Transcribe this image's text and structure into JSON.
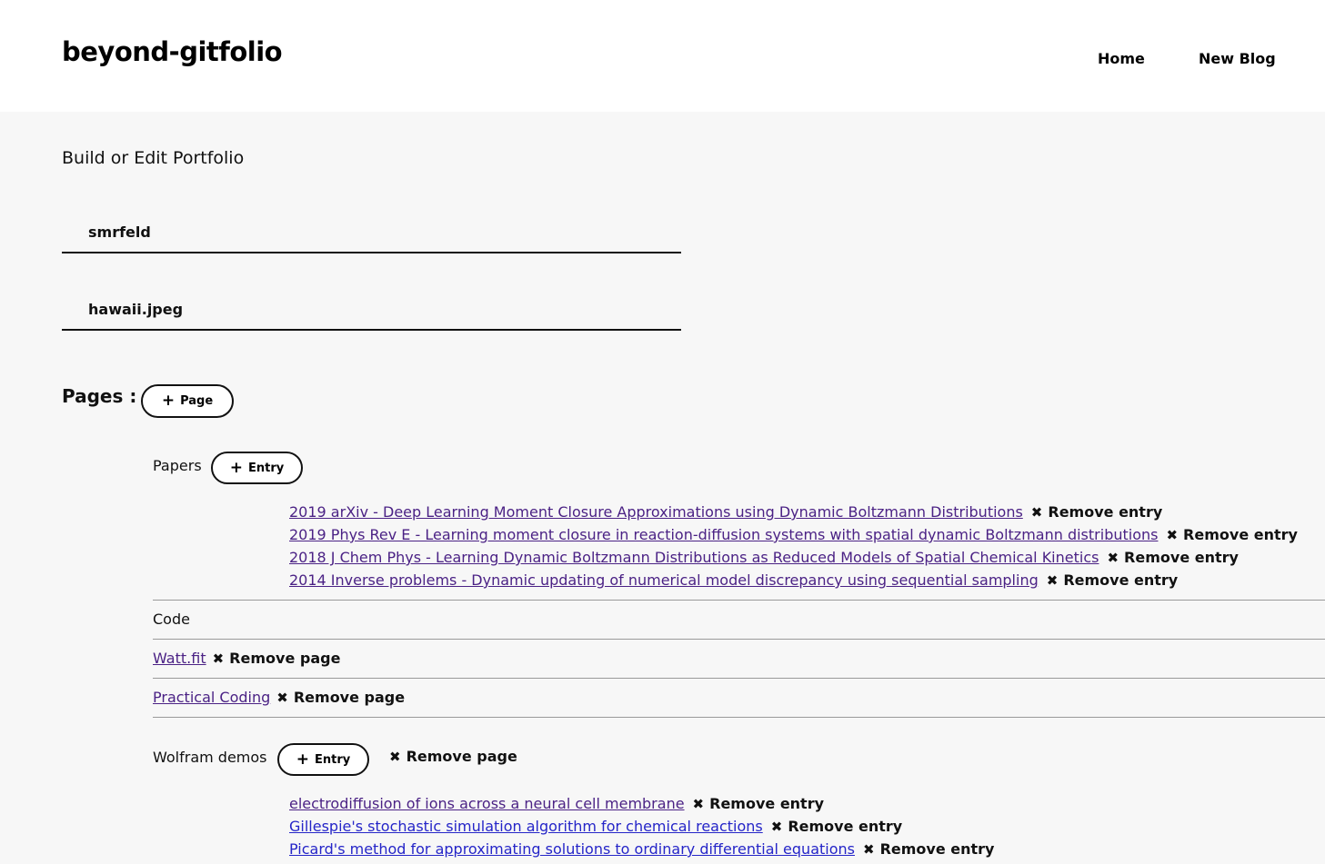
{
  "brand": "beyond-gitfolio",
  "nav": {
    "home": "Home",
    "new_blog": "New Blog"
  },
  "form": {
    "title": "Build or Edit Portfolio",
    "username_value": "smrfeld",
    "image_value": "hawaii.jpeg"
  },
  "pages_label": "Pages :",
  "add_page_label": "Page",
  "add_entry_label": "Entry",
  "remove_entry_label": "Remove entry",
  "remove_page_label": "Remove page",
  "papers": {
    "name": "Papers",
    "entries": [
      "2019 arXiv - Deep Learning Moment Closure Approximations using Dynamic Boltzmann Distributions",
      "2019 Phys Rev E - Learning moment closure in reaction-diffusion systems with spatial dynamic Boltzmann distributions",
      "2018 J Chem Phys - Learning Dynamic Boltzmann Distributions as Reduced Models of Spatial Chemical Kinetics",
      "2014 Inverse problems - Dynamic updating of numerical model discrepancy using sequential sampling"
    ]
  },
  "code": {
    "name": "Code"
  },
  "watt": {
    "name": "Watt.fit"
  },
  "practical": {
    "name": "Practical Coding"
  },
  "wolfram": {
    "name": "Wolfram demos",
    "entries": [
      "electrodiffusion of ions across a neural cell membrane",
      "Gillespie's stochastic simulation algorithm for chemical reactions",
      "Picard's method for approximating solutions to ordinary differential equations"
    ]
  },
  "colors": {
    "visited_link": "#4b2285",
    "link": "#2525c8",
    "background": "#f7f7f7"
  }
}
